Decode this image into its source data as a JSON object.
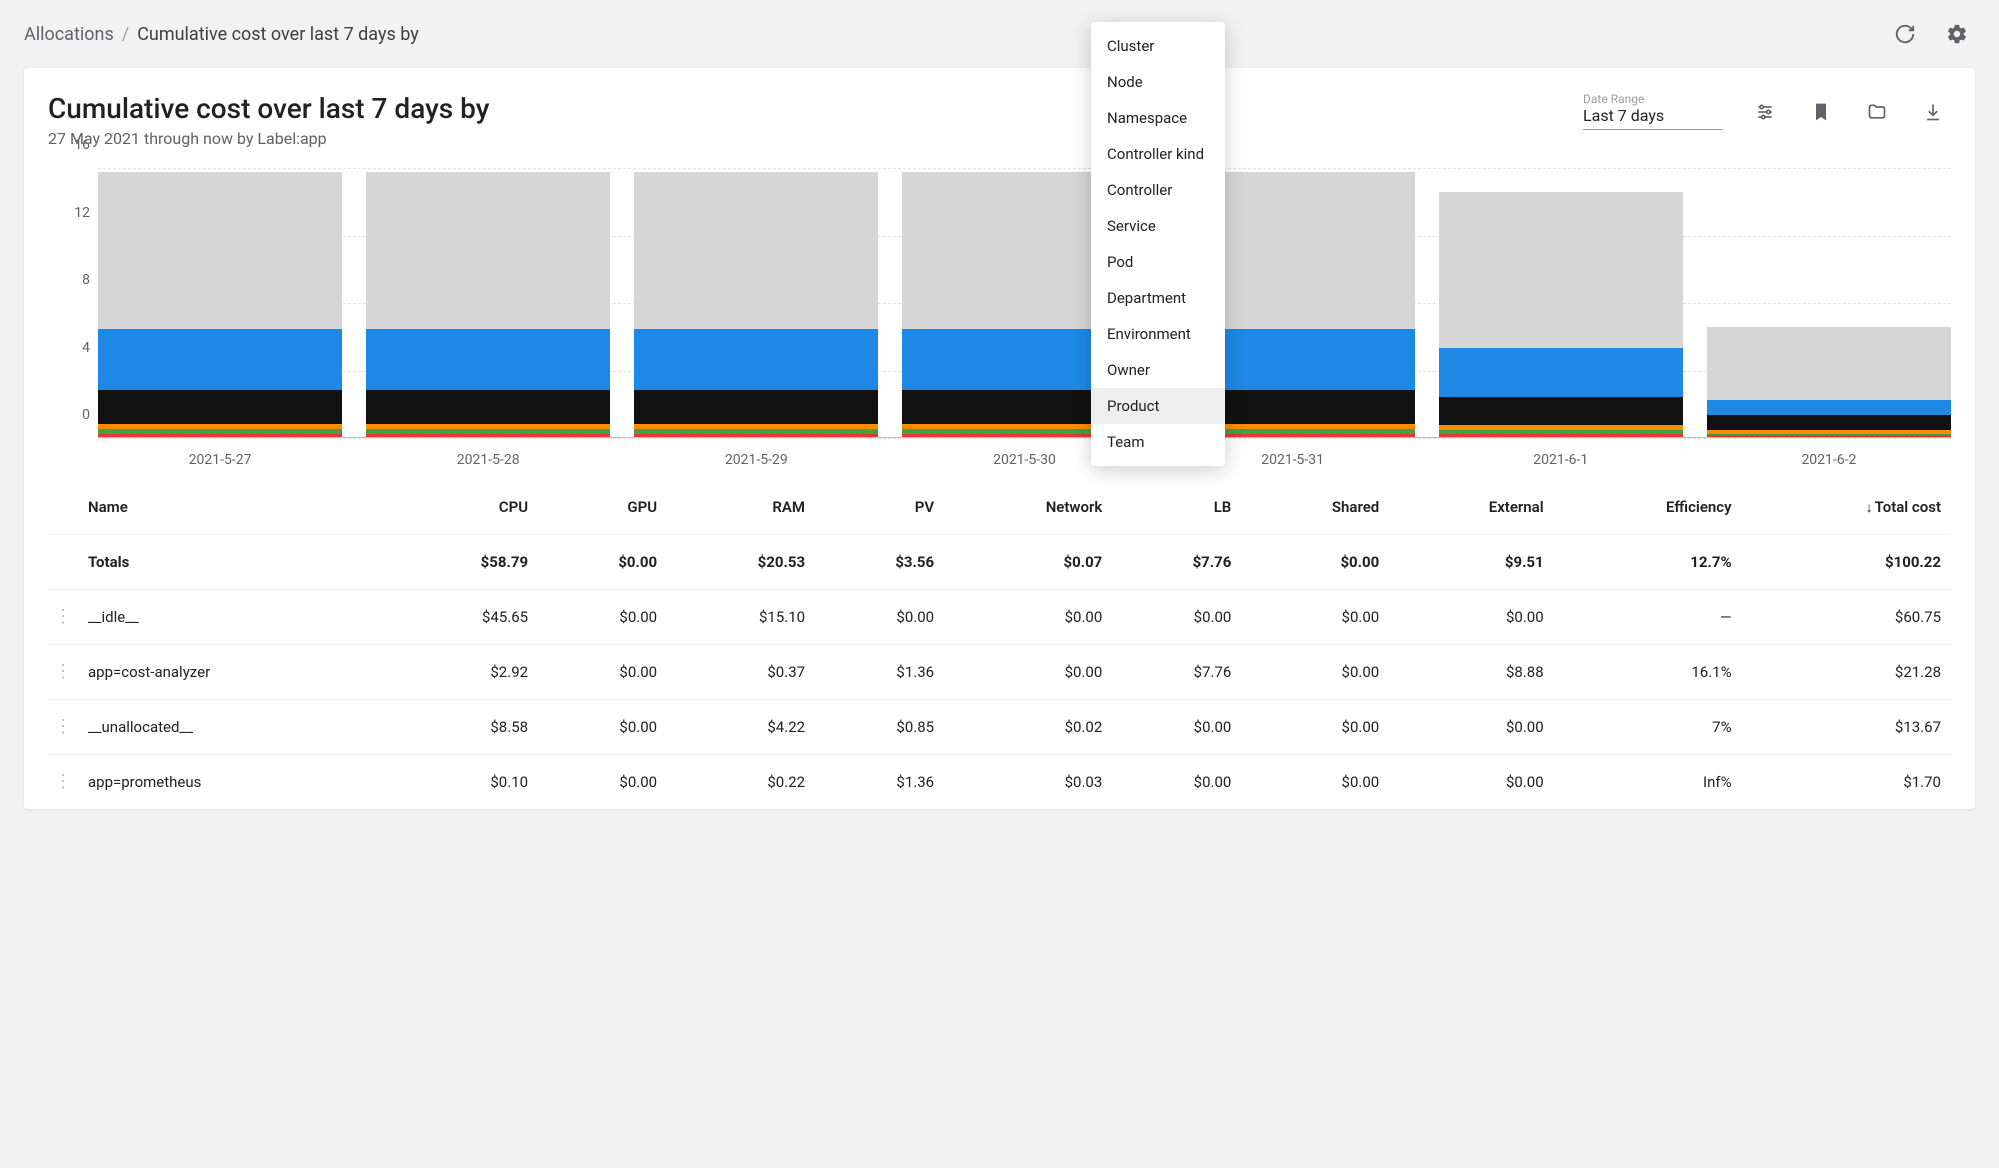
{
  "breadcrumb": {
    "root": "Allocations",
    "sep": "/",
    "current": "Cumulative cost over last 7 days by"
  },
  "header": {
    "title": "Cumulative cost over last 7 days by",
    "subtitle": "27 May 2021 through now by Label:app"
  },
  "date_range": {
    "label": "Date Range",
    "value": "Last 7 days"
  },
  "dropdown": {
    "items": [
      {
        "label": "Cluster",
        "selected": false
      },
      {
        "label": "Node",
        "selected": false
      },
      {
        "label": "Namespace",
        "selected": false
      },
      {
        "label": "Controller kind",
        "selected": false
      },
      {
        "label": "Controller",
        "selected": false
      },
      {
        "label": "Service",
        "selected": false
      },
      {
        "label": "Pod",
        "selected": false
      },
      {
        "label": "Department",
        "selected": false
      },
      {
        "label": "Environment",
        "selected": false
      },
      {
        "label": "Owner",
        "selected": false
      },
      {
        "label": "Product",
        "selected": true
      },
      {
        "label": "Team",
        "selected": false
      }
    ]
  },
  "chart_data": {
    "type": "bar",
    "title": "Cumulative cost over last 7 days by",
    "xlabel": "",
    "ylabel": "",
    "ylim": [
      0,
      16
    ],
    "yticks": [
      0,
      4,
      8,
      12,
      16
    ],
    "categories": [
      "2021-5-27",
      "2021-5-28",
      "2021-5-29",
      "2021-5-30",
      "2021-5-31",
      "2021-6-1",
      "2021-6-2"
    ],
    "series": [
      {
        "name": "red",
        "color": "#e53935",
        "values": [
          0.2,
          0.2,
          0.2,
          0.2,
          0.2,
          0.2,
          0.1
        ]
      },
      {
        "name": "green",
        "color": "#43a047",
        "values": [
          0.3,
          0.3,
          0.3,
          0.3,
          0.3,
          0.2,
          0.1
        ]
      },
      {
        "name": "orange",
        "color": "#fb8c00",
        "values": [
          0.3,
          0.3,
          0.3,
          0.3,
          0.3,
          0.3,
          0.2
        ]
      },
      {
        "name": "black",
        "color": "#111111",
        "values": [
          2.0,
          2.0,
          2.0,
          2.0,
          2.0,
          1.7,
          0.9
        ]
      },
      {
        "name": "blue",
        "color": "#1e88e5",
        "values": [
          3.6,
          3.6,
          3.6,
          3.6,
          3.6,
          2.9,
          0.9
        ]
      },
      {
        "name": "idle",
        "color": "#d6d6d6",
        "values": [
          9.3,
          9.3,
          9.3,
          9.3,
          9.3,
          9.2,
          4.3
        ]
      }
    ]
  },
  "table": {
    "columns": [
      "Name",
      "CPU",
      "GPU",
      "RAM",
      "PV",
      "Network",
      "LB",
      "Shared",
      "External",
      "Efficiency",
      "Total cost"
    ],
    "sort_indicator": "↓",
    "totals": {
      "name": "Totals",
      "cpu": "$58.79",
      "gpu": "$0.00",
      "ram": "$20.53",
      "pv": "$3.56",
      "network": "$0.07",
      "lb": "$7.76",
      "shared": "$0.00",
      "external": "$9.51",
      "efficiency": "12.7%",
      "total": "$100.22"
    },
    "rows": [
      {
        "name": "__idle__",
        "cpu": "$45.65",
        "gpu": "$0.00",
        "ram": "$15.10",
        "pv": "$0.00",
        "network": "$0.00",
        "lb": "$0.00",
        "shared": "$0.00",
        "external": "$0.00",
        "efficiency": "—",
        "total": "$60.75"
      },
      {
        "name": "app=cost-analyzer",
        "cpu": "$2.92",
        "gpu": "$0.00",
        "ram": "$0.37",
        "pv": "$1.36",
        "network": "$0.00",
        "lb": "$7.76",
        "shared": "$0.00",
        "external": "$8.88",
        "efficiency": "16.1%",
        "total": "$21.28"
      },
      {
        "name": "__unallocated__",
        "cpu": "$8.58",
        "gpu": "$0.00",
        "ram": "$4.22",
        "pv": "$0.85",
        "network": "$0.02",
        "lb": "$0.00",
        "shared": "$0.00",
        "external": "$0.00",
        "efficiency": "7%",
        "total": "$13.67"
      },
      {
        "name": "app=prometheus",
        "cpu": "$0.10",
        "gpu": "$0.00",
        "ram": "$0.22",
        "pv": "$1.36",
        "network": "$0.03",
        "lb": "$0.00",
        "shared": "$0.00",
        "external": "$0.00",
        "efficiency": "Inf%",
        "total": "$1.70"
      }
    ]
  }
}
